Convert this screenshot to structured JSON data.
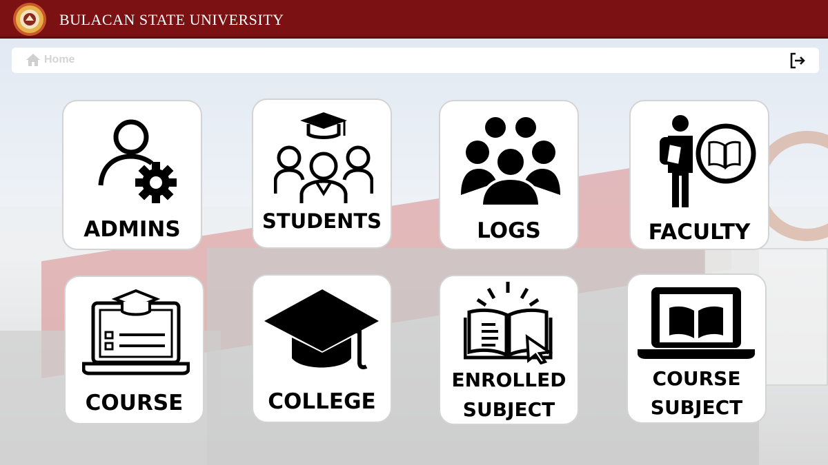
{
  "header": {
    "university_name": "BULACAN STATE UNIVERSITY",
    "brand_color": "#7b1113"
  },
  "breadcrumb": {
    "home_label": "Home",
    "home_icon": "home-icon"
  },
  "toolbar": {
    "logout_icon": "logout-icon"
  },
  "menu": {
    "admins": {
      "label": "ADMINS",
      "icon": "admin-settings-icon"
    },
    "students": {
      "label": "STUDENTS",
      "icon": "students-graduation-icon"
    },
    "logs": {
      "label": "LOGS",
      "icon": "people-group-icon"
    },
    "faculty": {
      "label": "FACULTY",
      "icon": "faculty-book-icon"
    },
    "course": {
      "label": "COURSE",
      "icon": "laptop-course-icon"
    },
    "college": {
      "label": "COLLEGE",
      "icon": "graduation-cap-icon"
    },
    "enrolled_subject": {
      "label_line1": "ENROLLED",
      "label_line2": "SUBJECT",
      "icon": "open-book-cursor-icon"
    },
    "course_subject": {
      "label_line1": "COURSE",
      "label_line2": "SUBJECT",
      "icon": "laptop-book-icon"
    }
  }
}
